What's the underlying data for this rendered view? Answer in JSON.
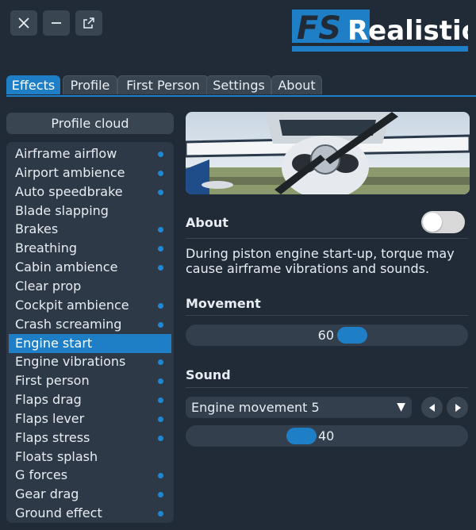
{
  "window": {
    "close_icon": "close-icon",
    "minimize_icon": "minimize-icon",
    "popout_icon": "popout-icon"
  },
  "logo": {
    "prefix": "FS",
    "text": "Realistic"
  },
  "tabs": [
    {
      "label": "Effects",
      "active": true
    },
    {
      "label": "Profile",
      "active": false
    },
    {
      "label": "First Person",
      "active": false
    },
    {
      "label": "Settings",
      "active": false
    },
    {
      "label": "About",
      "active": false
    }
  ],
  "sidebar": {
    "profile_cloud_label": "Profile cloud",
    "items": [
      {
        "label": "Airframe airflow",
        "dot": true
      },
      {
        "label": "Airport ambience",
        "dot": true
      },
      {
        "label": "Auto speedbrake",
        "dot": true
      },
      {
        "label": "Blade slapping",
        "dot": false
      },
      {
        "label": "Brakes",
        "dot": true
      },
      {
        "label": "Breathing",
        "dot": true
      },
      {
        "label": "Cabin ambience",
        "dot": true
      },
      {
        "label": "Clear prop",
        "dot": false
      },
      {
        "label": "Cockpit ambience",
        "dot": true
      },
      {
        "label": "Crash screaming",
        "dot": true
      },
      {
        "label": "Engine start",
        "dot": false,
        "selected": true
      },
      {
        "label": "Engine vibrations",
        "dot": true
      },
      {
        "label": "First person",
        "dot": true
      },
      {
        "label": "Flaps drag",
        "dot": true
      },
      {
        "label": "Flaps lever",
        "dot": true
      },
      {
        "label": "Flaps stress",
        "dot": true
      },
      {
        "label": "Floats splash",
        "dot": false
      },
      {
        "label": "G forces",
        "dot": true
      },
      {
        "label": "Gear drag",
        "dot": true
      },
      {
        "label": "Ground effect",
        "dot": true
      }
    ]
  },
  "detail": {
    "about_title": "About",
    "about_toggle_on": false,
    "description": "During piston engine start-up, torque may cause airframe vibrations and sounds.",
    "movement_title": "Movement",
    "movement_value": "60",
    "movement_fraction": 0.6,
    "sound_title": "Sound",
    "sound_selected": "Engine movement 5",
    "sound_value": "40",
    "sound_fraction": 0.4
  },
  "colors": {
    "accent": "#1f7fc6",
    "background": "#212b38",
    "panel": "#2e3947"
  }
}
